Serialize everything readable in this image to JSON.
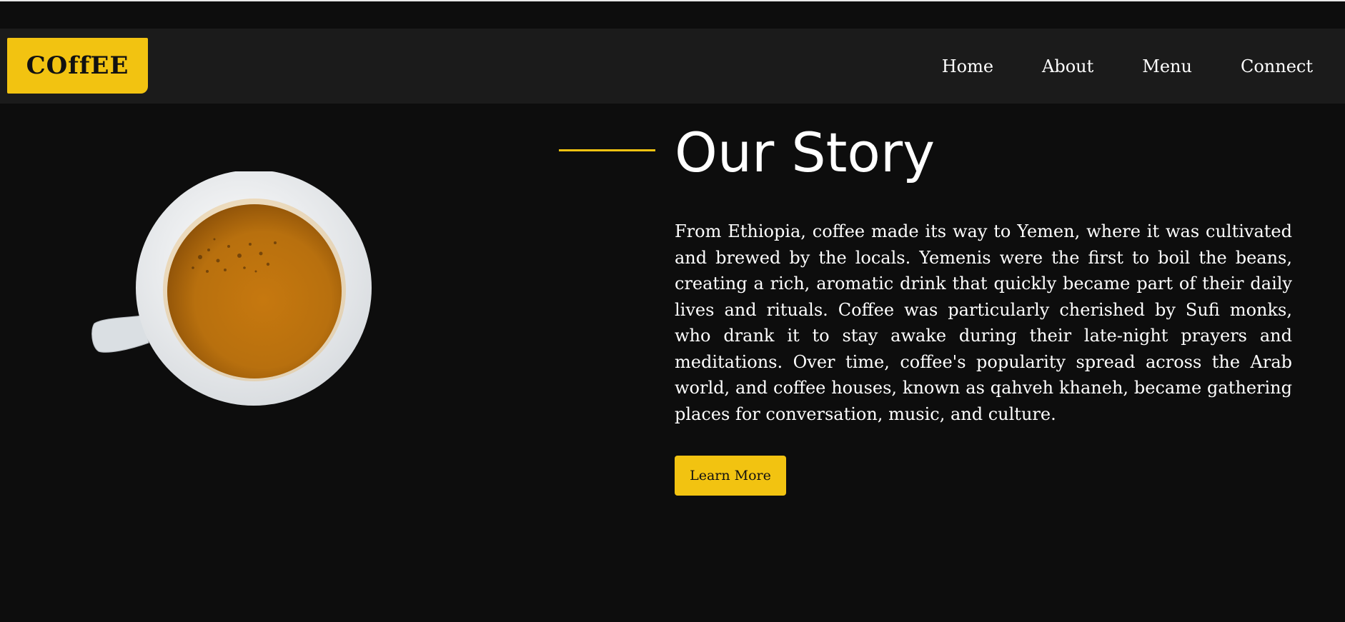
{
  "brand": {
    "logo_text": "COffEE",
    "accent_color": "#f2c311"
  },
  "nav": {
    "items": [
      {
        "label": "Home"
      },
      {
        "label": "About"
      },
      {
        "label": "Menu"
      },
      {
        "label": "Connect"
      }
    ]
  },
  "hero": {
    "title": "Our Story",
    "body": "From Ethiopia, coffee made its way to Yemen, where it was cultivated and brewed by the locals. Yemenis were the first to boil the beans, creating a rich, aromatic drink that quickly became part of their daily lives and rituals. Coffee was particularly cherished by Sufi monks, who drank it to stay awake during their late-night prayers and meditations. Over time, coffee's popularity spread across the Arab world, and coffee houses, known as qahveh khaneh, became gathering places for conversation, music, and culture.",
    "cta_label": "Learn More",
    "image_icon": "coffee-cup-icon"
  }
}
